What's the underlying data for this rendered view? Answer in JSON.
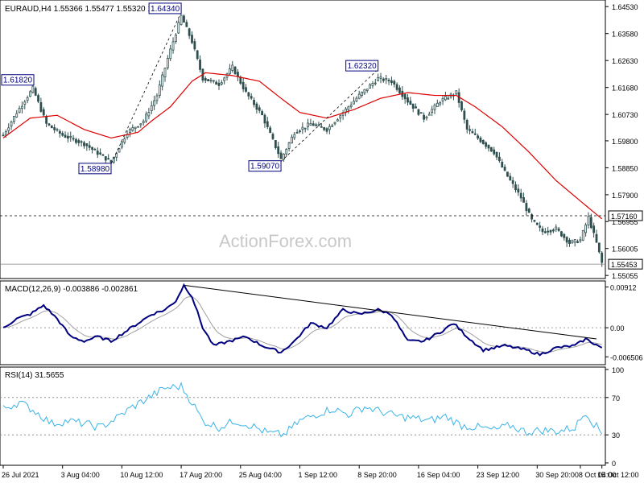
{
  "chart_data": [
    {
      "type": "candlestick",
      "panel": "price",
      "title": "EURAUD,H4  1.55366 1.55477 1.55320 1.55453",
      "watermark": "ActionForex.com",
      "ylim": [
        1.5506,
        1.6465
      ],
      "yticks": [
        "1.64530",
        "1.63580",
        "1.62630",
        "1.61680",
        "1.60730",
        "1.59800",
        "1.58850",
        "1.57900",
        "1.56955",
        "1.56005",
        "1.55055"
      ],
      "ytick_values": [
        1.6453,
        1.6358,
        1.6263,
        1.6168,
        1.6073,
        1.598,
        1.5885,
        1.579,
        1.56955,
        1.56005,
        1.55055
      ],
      "horizontal_line": {
        "value": 1.5716,
        "label": "1.57160"
      },
      "last_price": {
        "value": 1.55453,
        "label": "1.55453"
      },
      "annotations": [
        {
          "text": "1.64340",
          "value": 1.6434,
          "bar": 66
        },
        {
          "text": "1.61820",
          "value": 1.6182,
          "bar": 11
        },
        {
          "text": "1.58980",
          "value": 1.5898,
          "bar": 40
        },
        {
          "text": "1.59070",
          "value": 1.5907,
          "bar": 103
        },
        {
          "text": "1.62320",
          "value": 1.6232,
          "bar": 139
        }
      ],
      "anchors": [
        [
          0,
          1.6
        ],
        [
          5,
          1.608
        ],
        [
          11,
          1.6165
        ],
        [
          16,
          1.604
        ],
        [
          22,
          1.6
        ],
        [
          30,
          1.597
        ],
        [
          40,
          1.5905
        ],
        [
          46,
          1.601
        ],
        [
          52,
          1.605
        ],
        [
          57,
          1.614
        ],
        [
          61,
          1.627
        ],
        [
          66,
          1.642
        ],
        [
          70,
          1.633
        ],
        [
          74,
          1.62
        ],
        [
          80,
          1.618
        ],
        [
          85,
          1.624
        ],
        [
          90,
          1.615
        ],
        [
          96,
          1.607
        ],
        [
          103,
          1.5915
        ],
        [
          108,
          1.601
        ],
        [
          114,
          1.604
        ],
        [
          120,
          1.602
        ],
        [
          126,
          1.608
        ],
        [
          132,
          1.614
        ],
        [
          139,
          1.62
        ],
        [
          144,
          1.619
        ],
        [
          150,
          1.612
        ],
        [
          156,
          1.606
        ],
        [
          162,
          1.612
        ],
        [
          168,
          1.615
        ],
        [
          172,
          1.602
        ],
        [
          176,
          1.599
        ],
        [
          182,
          1.594
        ],
        [
          186,
          1.587
        ],
        [
          192,
          1.578
        ],
        [
          196,
          1.57
        ],
        [
          200,
          1.566
        ],
        [
          205,
          1.567
        ],
        [
          210,
          1.562
        ],
        [
          214,
          1.563
        ],
        [
          217,
          1.571
        ],
        [
          220,
          1.562
        ],
        [
          222,
          1.555
        ]
      ],
      "moving_average_anchors": [
        [
          0,
          1.599
        ],
        [
          10,
          1.606
        ],
        [
          20,
          1.607
        ],
        [
          30,
          1.602
        ],
        [
          40,
          1.599
        ],
        [
          50,
          1.601
        ],
        [
          55,
          1.605
        ],
        [
          62,
          1.61
        ],
        [
          70,
          1.619
        ],
        [
          75,
          1.622
        ],
        [
          85,
          1.621
        ],
        [
          95,
          1.619
        ],
        [
          103,
          1.613
        ],
        [
          110,
          1.608
        ],
        [
          120,
          1.606
        ],
        [
          130,
          1.609
        ],
        [
          140,
          1.613
        ],
        [
          150,
          1.615
        ],
        [
          160,
          1.614
        ],
        [
          168,
          1.614
        ],
        [
          175,
          1.61
        ],
        [
          185,
          1.603
        ],
        [
          195,
          1.594
        ],
        [
          205,
          1.584
        ],
        [
          215,
          1.576
        ],
        [
          222,
          1.5705
        ]
      ]
    },
    {
      "type": "line",
      "panel": "macd",
      "title": "MACD(12,26,9) -0.003886 -0.002861",
      "ylim": [
        -0.0079,
        0.0101
      ],
      "yticks": [
        "0.00912",
        "0.00",
        "-0.006506"
      ],
      "ytick_values": [
        0.00912,
        0,
        -0.006506
      ],
      "trendline": {
        "from": [
          67,
          0.0095
        ],
        "to": [
          220,
          -0.0025
        ]
      },
      "anchors": [
        [
          0,
          0.0
        ],
        [
          5,
          0.002
        ],
        [
          10,
          0.003
        ],
        [
          15,
          0.005
        ],
        [
          20,
          0.002
        ],
        [
          25,
          -0.002
        ],
        [
          30,
          -0.003
        ],
        [
          35,
          -0.002
        ],
        [
          40,
          -0.003
        ],
        [
          45,
          -0.001
        ],
        [
          50,
          0.001
        ],
        [
          55,
          0.003
        ],
        [
          60,
          0.004
        ],
        [
          64,
          0.006
        ],
        [
          67,
          0.0095
        ],
        [
          70,
          0.007
        ],
        [
          74,
          0.0
        ],
        [
          78,
          -0.004
        ],
        [
          84,
          -0.003
        ],
        [
          90,
          -0.002
        ],
        [
          96,
          -0.004
        ],
        [
          103,
          -0.0055
        ],
        [
          108,
          -0.003
        ],
        [
          114,
          0.001
        ],
        [
          120,
          0.0
        ],
        [
          126,
          0.004
        ],
        [
          132,
          0.003
        ],
        [
          139,
          0.004
        ],
        [
          144,
          0.003
        ],
        [
          150,
          -0.003
        ],
        [
          156,
          -0.003
        ],
        [
          162,
          -0.001
        ],
        [
          167,
          0.001
        ],
        [
          172,
          -0.002
        ],
        [
          178,
          -0.005
        ],
        [
          186,
          -0.004
        ],
        [
          194,
          -0.005
        ],
        [
          199,
          -0.006
        ],
        [
          205,
          -0.0045
        ],
        [
          212,
          -0.004
        ],
        [
          216,
          -0.0025
        ],
        [
          222,
          -0.0045
        ]
      ]
    },
    {
      "type": "line",
      "panel": "rsi",
      "title": "RSI(14) 31.5655",
      "ylim": [
        0,
        100
      ],
      "yticks": [
        "100",
        "70",
        "30",
        "0"
      ],
      "ytick_values": [
        100,
        70,
        30,
        0
      ],
      "levels": [
        70,
        30
      ],
      "anchors": [
        [
          0,
          58
        ],
        [
          6,
          65
        ],
        [
          12,
          55
        ],
        [
          18,
          42
        ],
        [
          24,
          45
        ],
        [
          30,
          42
        ],
        [
          36,
          38
        ],
        [
          42,
          48
        ],
        [
          48,
          60
        ],
        [
          54,
          70
        ],
        [
          60,
          80
        ],
        [
          66,
          82
        ],
        [
          70,
          65
        ],
        [
          74,
          45
        ],
        [
          80,
          38
        ],
        [
          86,
          45
        ],
        [
          92,
          40
        ],
        [
          98,
          32
        ],
        [
          104,
          30
        ],
        [
          110,
          45
        ],
        [
          116,
          52
        ],
        [
          122,
          58
        ],
        [
          128,
          52
        ],
        [
          134,
          60
        ],
        [
          140,
          55
        ],
        [
          146,
          50
        ],
        [
          152,
          48
        ],
        [
          158,
          45
        ],
        [
          164,
          50
        ],
        [
          170,
          40
        ],
        [
          176,
          38
        ],
        [
          182,
          35
        ],
        [
          188,
          40
        ],
        [
          194,
          33
        ],
        [
          200,
          35
        ],
        [
          206,
          34
        ],
        [
          212,
          38
        ],
        [
          216,
          55
        ],
        [
          219,
          42
        ],
        [
          222,
          32
        ]
      ]
    }
  ],
  "x_axis": {
    "labels": [
      "26 Jul 2021",
      "3 Aug 04:00",
      "10 Aug 12:00",
      "17 Aug 20:00",
      "25 Aug 04:00",
      "1 Sep 12:00",
      "8 Sep 20:00",
      "16 Sep 04:00",
      "23 Sep 12:00",
      "30 Sep 20:00",
      "8 Oct 04:00",
      "15 Oct 12:00"
    ],
    "label_bars": [
      0,
      22,
      44,
      66,
      88,
      110,
      132,
      154,
      176,
      198,
      214,
      222
    ]
  },
  "colors": {
    "candle": "#2f4f4f",
    "moving_average": "#dd0000",
    "macd": "#000080",
    "signal": "#a0a0a0",
    "trendline": "#000000",
    "rsi": "#3cb4e6",
    "grid_dotted": "#808080",
    "watermark": "#c8c8c8",
    "label_border": "#000080"
  }
}
